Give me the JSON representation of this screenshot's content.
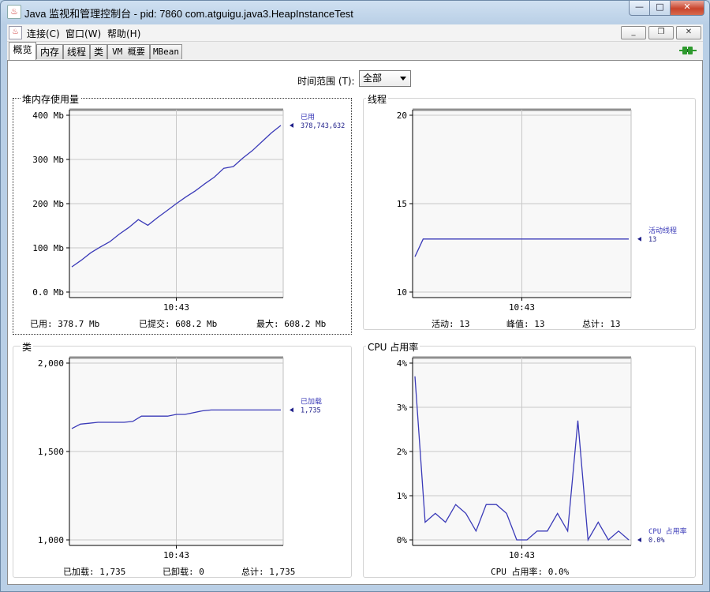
{
  "window": {
    "title": "Java 监视和管理控制台 - pid: 7860 com.atguigu.java3.HeapInstanceTest",
    "icon": "java-icon",
    "minimize": "—",
    "maximize": "□",
    "close": "✕"
  },
  "menu": {
    "items": [
      "连接(C)",
      "窗口(W)",
      "帮助(H)"
    ],
    "inner_minimize": "_",
    "inner_restore": "❐",
    "inner_close": "✕"
  },
  "tabs": [
    "概览",
    "内存",
    "线程",
    "类",
    "VM 概要",
    "MBean"
  ],
  "active_tab": 0,
  "time_range": {
    "label": "时间范围 (T):",
    "value": "全部"
  },
  "colors": {
    "series": "#3a3ab8",
    "plot_bg": "#f8f8f8",
    "grid": "#c8c8c8",
    "connected": "#2e9a2e"
  },
  "panels": {
    "heap": {
      "title": "堆内存使用量",
      "summary": [
        {
          "label": "已用:",
          "value": "378.7 Mb"
        },
        {
          "label": "已提交:",
          "value": "608.2 Mb"
        },
        {
          "label": "最大:",
          "value": "608.2 Mb"
        }
      ]
    },
    "threads": {
      "title": "线程",
      "summary": [
        {
          "label": "活动:",
          "value": "13"
        },
        {
          "label": "峰值:",
          "value": "13"
        },
        {
          "label": "总计:",
          "value": "13"
        }
      ]
    },
    "classes": {
      "title": "类",
      "summary": [
        {
          "label": "已加载:",
          "value": "1,735"
        },
        {
          "label": "已卸载:",
          "value": "0"
        },
        {
          "label": "总计:",
          "value": "1,735"
        }
      ]
    },
    "cpu": {
      "title": "CPU 占用率",
      "summary": [
        {
          "label": "CPU 占用率:",
          "value": "0.0%"
        }
      ]
    }
  },
  "chart_data": [
    {
      "type": "line",
      "title": "堆内存使用量",
      "ylim": [
        0,
        400
      ],
      "yticks": [
        0,
        100,
        200,
        300,
        400
      ],
      "ytick_labels": [
        "0.0 Mb",
        "100 Mb",
        "200 Mb",
        "300 Mb",
        "400 Mb"
      ],
      "xtick_labels": [
        "10:43"
      ],
      "series": [
        {
          "name": "已用",
          "current": "378,743,632",
          "values": [
            57,
            72,
            89,
            102,
            114,
            131,
            146,
            164,
            151,
            168,
            184,
            200,
            215,
            229,
            245,
            260,
            280,
            284,
            303,
            320,
            340,
            360,
            377
          ]
        }
      ]
    },
    {
      "type": "line",
      "title": "线程",
      "ylim": [
        10,
        20
      ],
      "yticks": [
        10,
        15,
        20
      ],
      "ytick_labels": [
        "10",
        "15",
        "20"
      ],
      "xtick_labels": [
        "10:43"
      ],
      "series": [
        {
          "name": "活动线程",
          "current": "13",
          "values": [
            12,
            13,
            13,
            13,
            13,
            13,
            13,
            13,
            13,
            13,
            13,
            13,
            13,
            13,
            13,
            13,
            13,
            13,
            13,
            13,
            13,
            13,
            13,
            13,
            13,
            13,
            13
          ]
        }
      ]
    },
    {
      "type": "line",
      "title": "类",
      "ylim": [
        1000,
        2000
      ],
      "yticks": [
        1000,
        1500,
        2000
      ],
      "ytick_labels": [
        "1,000",
        "1,500",
        "2,000"
      ],
      "xtick_labels": [
        "10:43"
      ],
      "series": [
        {
          "name": "已加载",
          "current": "1,735",
          "values": [
            1630,
            1655,
            1660,
            1665,
            1665,
            1665,
            1665,
            1670,
            1700,
            1700,
            1700,
            1700,
            1710,
            1710,
            1720,
            1730,
            1735,
            1735,
            1735,
            1735,
            1735,
            1735,
            1735,
            1735,
            1735
          ]
        }
      ]
    },
    {
      "type": "line",
      "title": "CPU 占用率",
      "ylim": [
        0,
        4
      ],
      "yticks": [
        0,
        1,
        2,
        3,
        4
      ],
      "ytick_labels": [
        "0%",
        "1%",
        "2%",
        "3%",
        "4%"
      ],
      "xtick_labels": [
        "10:43"
      ],
      "series": [
        {
          "name": "CPU 占用率",
          "current": "0.0%",
          "values": [
            3.7,
            0.4,
            0.6,
            0.4,
            0.8,
            0.6,
            0.2,
            0.8,
            0.8,
            0.6,
            0.0,
            0.0,
            0.2,
            0.2,
            0.6,
            0.2,
            2.7,
            0.0,
            0.4,
            0.0,
            0.2,
            0.0
          ]
        }
      ]
    }
  ]
}
